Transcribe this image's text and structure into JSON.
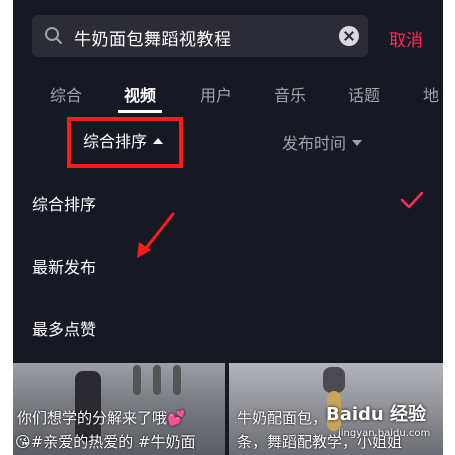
{
  "search": {
    "query": "牛奶面包舞蹈视教程",
    "cancel_label": "取消"
  },
  "tabs": [
    {
      "label": "综合"
    },
    {
      "label": "视频",
      "active": true
    },
    {
      "label": "用户"
    },
    {
      "label": "音乐"
    },
    {
      "label": "话题"
    },
    {
      "label": "地"
    }
  ],
  "filters": {
    "sort_label": "综合排序",
    "time_label": "发布时间"
  },
  "sort_options": [
    {
      "label": "综合排序",
      "selected": true
    },
    {
      "label": "最新发布"
    },
    {
      "label": "最多点赞"
    }
  ],
  "videos": [
    {
      "line1": "你们想学的分解来了哦💕",
      "line2": "😘#亲爱的热爱的 #牛奶面"
    },
    {
      "line1": "牛奶配面包，",
      "line2": "条，舞蹈配教学，小姐姐"
    }
  ],
  "watermark": {
    "logo_text": "Baidu 经验",
    "url": "jingyan.baidu.com"
  },
  "colors": {
    "background": "#161823",
    "accent": "#fe2c55",
    "annotation": "#ff1a1a"
  }
}
